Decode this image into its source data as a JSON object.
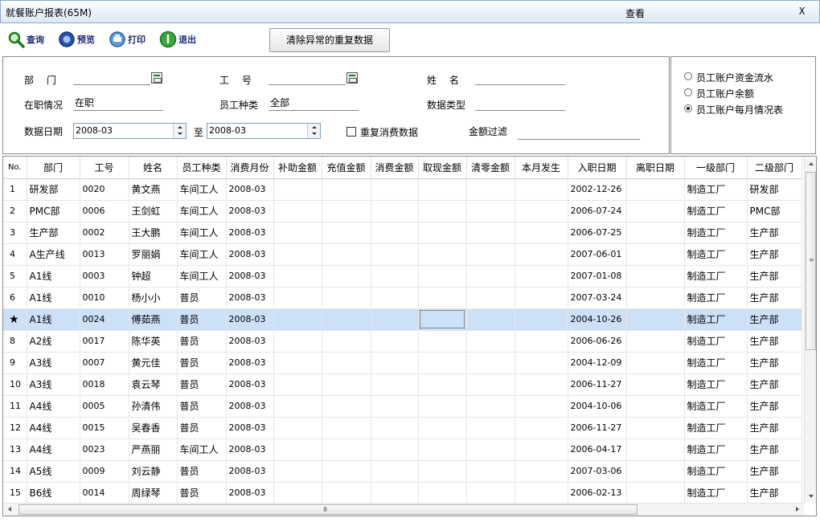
{
  "window": {
    "title": "就餐账户报表(65M)",
    "view_label": "查看",
    "close_label": "X"
  },
  "toolbar": {
    "query": "查询",
    "preview": "预览",
    "print": "打印",
    "exit": "退出",
    "clean_button": "清除异常的重复数据"
  },
  "filter": {
    "dept_label": "部　 门",
    "dept_value": "",
    "empno_label": "工　 号",
    "empno_value": "",
    "name_label": "姓　 名",
    "name_value": "",
    "status_label": "在职情况",
    "status_value": "在职",
    "emptype_label": "员工种类",
    "emptype_value": "全部",
    "datatype_label": "数据类型",
    "datatype_value": "",
    "date_label": "数据日期",
    "date_from": "2008-03",
    "to_label": "至",
    "date_to": "2008-03",
    "dup_label": "重复消费数据",
    "dup_checked": false,
    "amount_label": "金额过滤",
    "amount_value": ""
  },
  "report_options": [
    {
      "label": "员工账户资金流水",
      "selected": false
    },
    {
      "label": "员工账户余额",
      "selected": false
    },
    {
      "label": "员工账户每月情况表",
      "selected": true
    }
  ],
  "table": {
    "columns": [
      "No.",
      "部门",
      "工号",
      "姓名",
      "员工种类",
      "消费月份",
      "补助金额",
      "充值金额",
      "消费金额",
      "取现金额",
      "清零金额",
      "本月发生",
      "入职日期",
      "离职日期",
      "一级部门",
      "二级部门"
    ],
    "selected_marker": "★",
    "rows": [
      {
        "no": "1",
        "dept": "研发部",
        "id": "0020",
        "name": "黄文燕",
        "type": "车间工人",
        "month": "2008-03",
        "hire": "2002-12-26",
        "d1": "制造工厂",
        "d2": "研发部"
      },
      {
        "no": "2",
        "dept": "PMC部",
        "id": "0006",
        "name": "王剑虹",
        "type": "车间工人",
        "month": "2008-03",
        "hire": "2006-07-24",
        "d1": "制造工厂",
        "d2": "PMC部"
      },
      {
        "no": "3",
        "dept": "生产部",
        "id": "0002",
        "name": "王大鹏",
        "type": "车间工人",
        "month": "2008-03",
        "hire": "2006-07-25",
        "d1": "制造工厂",
        "d2": "生产部"
      },
      {
        "no": "4",
        "dept": "A生产线",
        "id": "0013",
        "name": "罗丽娟",
        "type": "车间工人",
        "month": "2008-03",
        "hire": "2007-06-01",
        "d1": "制造工厂",
        "d2": "生产部"
      },
      {
        "no": "5",
        "dept": "A1线",
        "id": "0003",
        "name": "钟超",
        "type": "车间工人",
        "month": "2008-03",
        "hire": "2007-01-08",
        "d1": "制造工厂",
        "d2": "生产部"
      },
      {
        "no": "6",
        "dept": "A1线",
        "id": "0010",
        "name": "杨小小",
        "type": "普员",
        "month": "2008-03",
        "hire": "2007-03-24",
        "d1": "制造工厂",
        "d2": "生产部"
      },
      {
        "no": "7",
        "dept": "A1线",
        "id": "0024",
        "name": "傅茹燕",
        "type": "普员",
        "month": "2008-03",
        "hire": "2004-10-26",
        "d1": "制造工厂",
        "d2": "生产部",
        "selected": true
      },
      {
        "no": "8",
        "dept": "A2线",
        "id": "0017",
        "name": "陈华英",
        "type": "普员",
        "month": "2008-03",
        "hire": "2006-06-26",
        "d1": "制造工厂",
        "d2": "生产部"
      },
      {
        "no": "9",
        "dept": "A3线",
        "id": "0007",
        "name": "黄元佳",
        "type": "普员",
        "month": "2008-03",
        "hire": "2004-12-09",
        "d1": "制造工厂",
        "d2": "生产部"
      },
      {
        "no": "10",
        "dept": "A3线",
        "id": "0018",
        "name": "袁云琴",
        "type": "普员",
        "month": "2008-03",
        "hire": "2006-11-27",
        "d1": "制造工厂",
        "d2": "生产部"
      },
      {
        "no": "11",
        "dept": "A4线",
        "id": "0005",
        "name": "孙清伟",
        "type": "普员",
        "month": "2008-03",
        "hire": "2004-10-06",
        "d1": "制造工厂",
        "d2": "生产部"
      },
      {
        "no": "12",
        "dept": "A4线",
        "id": "0015",
        "name": "吴春香",
        "type": "普员",
        "month": "2008-03",
        "hire": "2006-11-27",
        "d1": "制造工厂",
        "d2": "生产部"
      },
      {
        "no": "13",
        "dept": "A4线",
        "id": "0023",
        "name": "严燕丽",
        "type": "车间工人",
        "month": "2008-03",
        "hire": "2006-04-17",
        "d1": "制造工厂",
        "d2": "生产部"
      },
      {
        "no": "14",
        "dept": "A5线",
        "id": "0009",
        "name": "刘云静",
        "type": "普员",
        "month": "2008-03",
        "hire": "2007-03-06",
        "d1": "制造工厂",
        "d2": "生产部"
      },
      {
        "no": "15",
        "dept": "B6线",
        "id": "0014",
        "name": "周绿琴",
        "type": "普员",
        "month": "2008-03",
        "hire": "2006-02-13",
        "d1": "制造工厂",
        "d2": "生产部"
      }
    ]
  },
  "hscroll_grip": "III"
}
